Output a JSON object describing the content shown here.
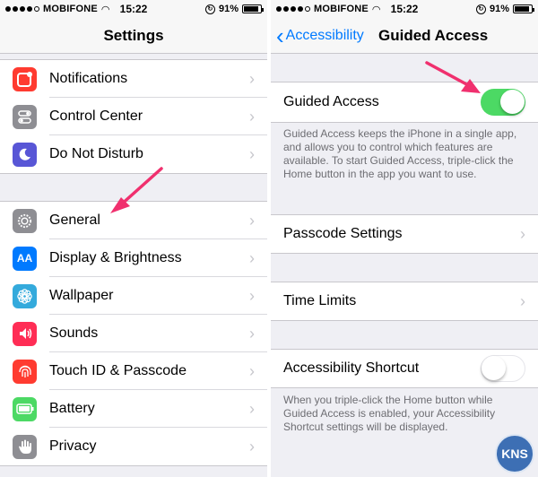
{
  "status": {
    "carrier": "MOBIFONE",
    "time": "15:22",
    "battery": "91%",
    "battery_level": 0.91
  },
  "left": {
    "title": "Settings",
    "group1": [
      {
        "label": "Notifications",
        "icon": "notifications-icon",
        "color": "#ff3b30"
      },
      {
        "label": "Control Center",
        "icon": "control-center-icon",
        "color": "#8e8e93"
      },
      {
        "label": "Do Not Disturb",
        "icon": "moon-icon",
        "color": "#5856d6"
      }
    ],
    "group2": [
      {
        "label": "General",
        "icon": "gear-icon",
        "color": "#8e8e93"
      },
      {
        "label": "Display & Brightness",
        "icon": "display-icon",
        "color": "#007aff"
      },
      {
        "label": "Wallpaper",
        "icon": "wallpaper-icon",
        "color": "#34aadc"
      },
      {
        "label": "Sounds",
        "icon": "speaker-icon",
        "color": "#ff2d55"
      },
      {
        "label": "Touch ID & Passcode",
        "icon": "fingerprint-icon",
        "color": "#ff3b30"
      },
      {
        "label": "Battery",
        "icon": "battery-icon",
        "color": "#4cd964"
      },
      {
        "label": "Privacy",
        "icon": "hand-icon",
        "color": "#8e8e93"
      }
    ]
  },
  "right": {
    "back_label": "Accessibility",
    "title": "Guided Access",
    "guided_access": {
      "label": "Guided Access",
      "on": true
    },
    "guided_access_desc": "Guided Access keeps the iPhone in a single app, and allows you to control which features are available. To start Guided Access, triple-click the Home button in the app you want to use.",
    "passcode_settings": "Passcode Settings",
    "time_limits": "Time Limits",
    "shortcut": {
      "label": "Accessibility Shortcut",
      "on": false
    },
    "shortcut_desc": "When you triple-click the Home button while Guided Access is enabled, your Accessibility Shortcut settings will be displayed."
  },
  "watermark": "KNS",
  "colors": {
    "ios_blue": "#007aff",
    "toggle_green": "#4cd964",
    "arrow_pink": "#f0306e"
  }
}
